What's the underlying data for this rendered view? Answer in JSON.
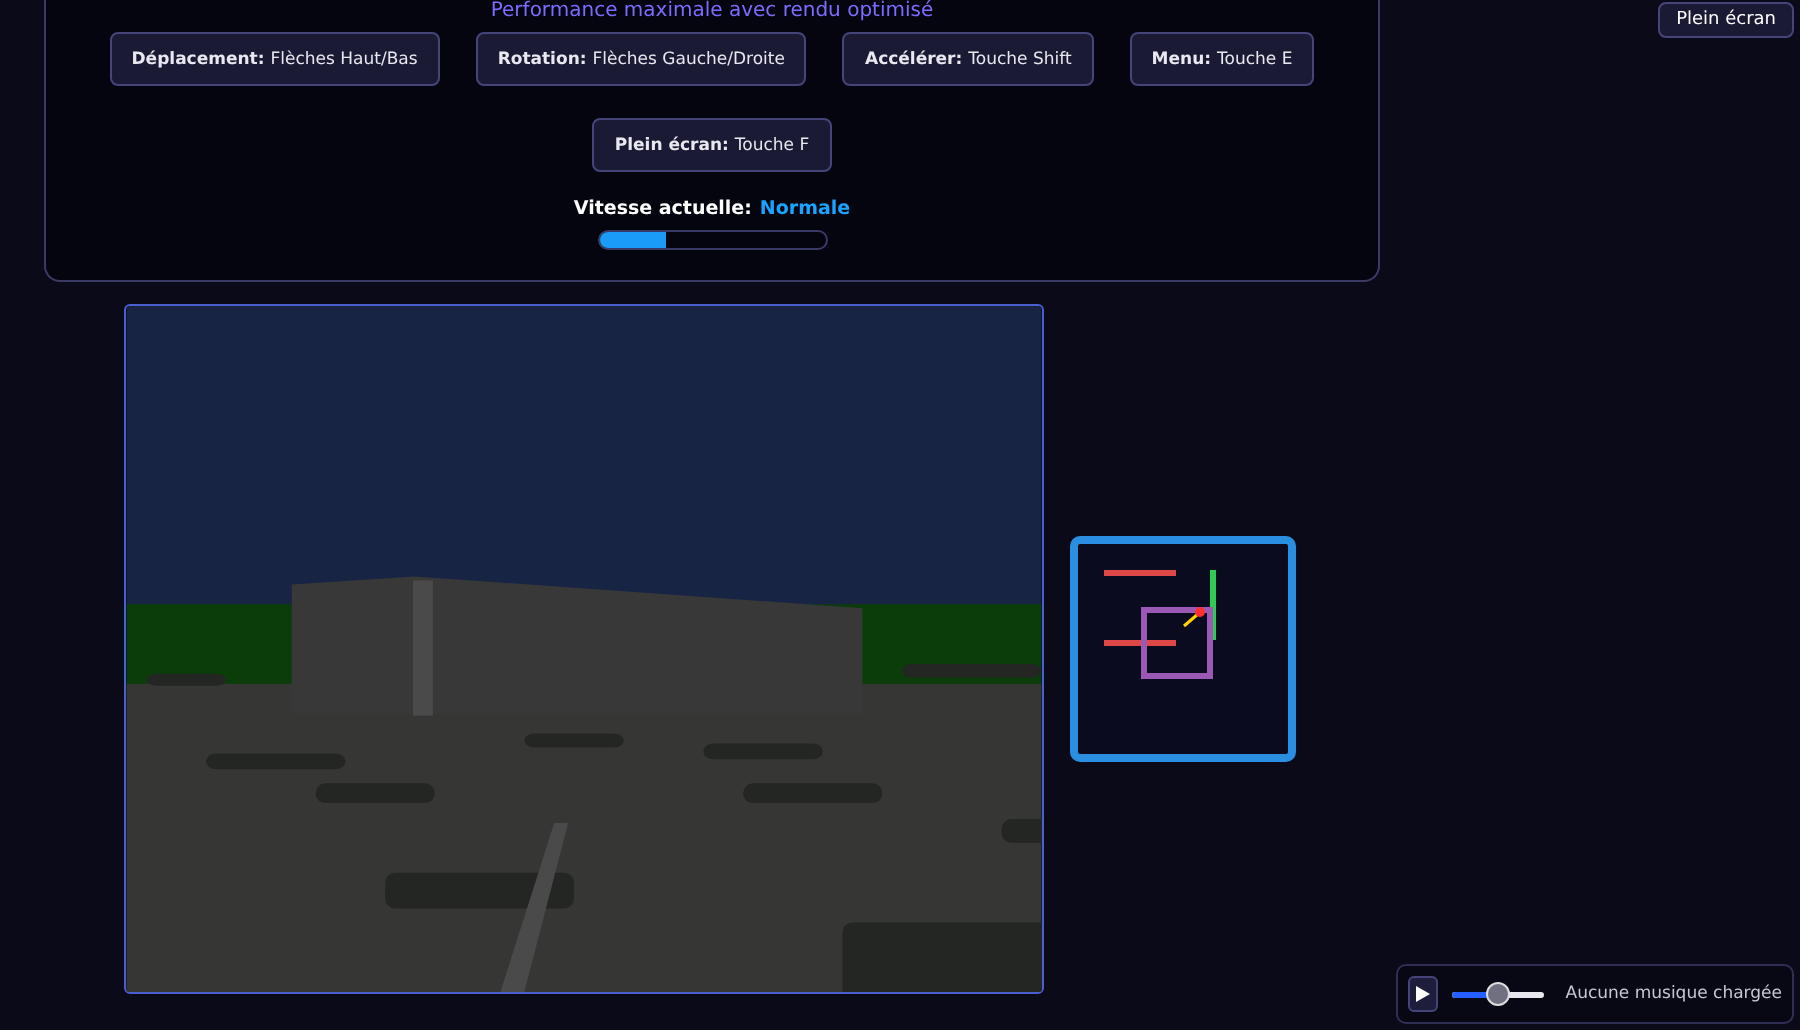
{
  "header": {
    "subtitle": "Performance maximale avec rendu optimisé",
    "controls": [
      {
        "label": "Déplacement:",
        "value": "Flèches Haut/Bas"
      },
      {
        "label": "Rotation:",
        "value": "Flèches Gauche/Droite"
      },
      {
        "label": "Accélérer:",
        "value": "Touche Shift"
      },
      {
        "label": "Menu:",
        "value": "Touche E"
      },
      {
        "label": "Plein écran:",
        "value": "Touche F"
      }
    ],
    "speed": {
      "label": "Vitesse actuelle:",
      "value": "Normale",
      "level": 0.3
    }
  },
  "fullscreen_button": "Plein écran",
  "music_player": {
    "volume": {
      "level": 0.5
    },
    "status": "Aucune musique chargée"
  }
}
